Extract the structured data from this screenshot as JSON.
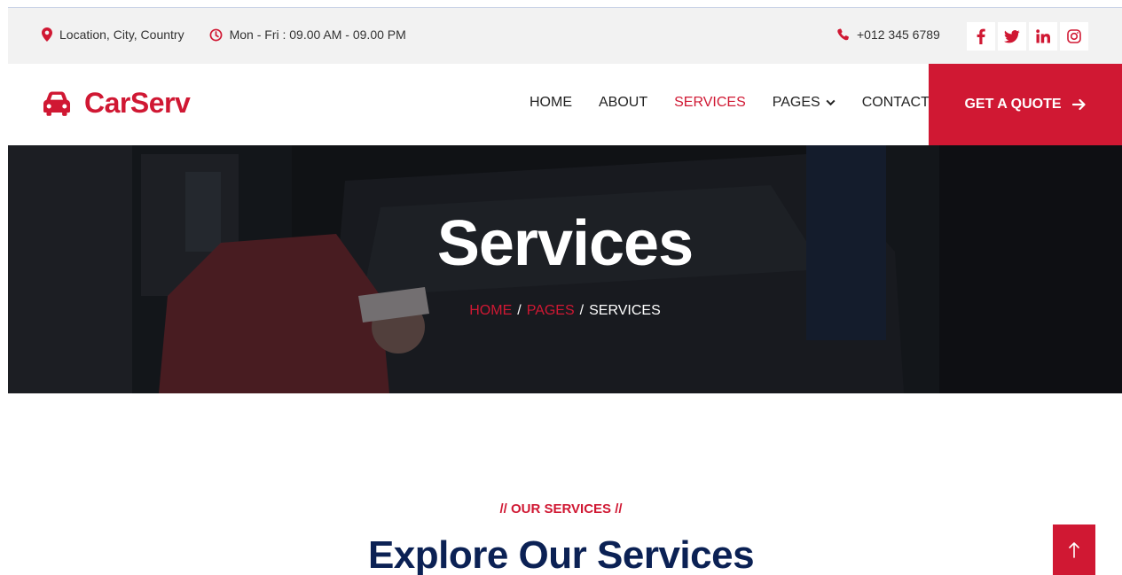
{
  "topbar": {
    "location": "Location, City, Country",
    "hours": "Mon - Fri : 09.00 AM - 09.00 PM",
    "phone": "+012 345 6789",
    "social": [
      "f",
      "y",
      "in",
      "ig"
    ]
  },
  "nav": {
    "brand": "CarServ",
    "items": [
      {
        "label": "HOME"
      },
      {
        "label": "ABOUT"
      },
      {
        "label": "SERVICES"
      },
      {
        "label": "PAGES"
      },
      {
        "label": "CONTACT"
      }
    ],
    "quote": "GET A QUOTE"
  },
  "hero": {
    "title": "Services",
    "breadcrumb": {
      "home": "HOME",
      "pages": "PAGES",
      "current": "SERVICES",
      "separator": "/"
    }
  },
  "section": {
    "kicker": "// OUR SERVICES //",
    "title": "Explore Our Services"
  },
  "colors": {
    "accent": "#d01833",
    "navy": "#0b2154",
    "topbar_bg": "#f2f2f2"
  },
  "icons": {
    "location": "map-marker-icon",
    "clock": "clock-icon",
    "phone": "phone-icon",
    "car": "car-icon",
    "arrow": "arrow-right-icon",
    "back_to_top": "arrow-up-icon"
  }
}
